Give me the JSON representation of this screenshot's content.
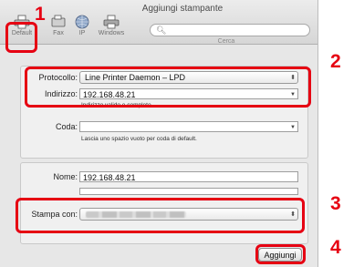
{
  "window": {
    "title": "Aggiungi stampante"
  },
  "toolbar": {
    "items": [
      {
        "label": "Default",
        "icon": "printer-icon"
      },
      {
        "label": "Fax",
        "icon": "fax-icon"
      },
      {
        "label": "IP",
        "icon": "globe-icon"
      },
      {
        "label": "Windows",
        "icon": "windows-printer-icon"
      }
    ],
    "search_label": "Cerca",
    "search_value": ""
  },
  "form": {
    "protocol_label": "Protocollo:",
    "protocol_value": "Line Printer Daemon – LPD",
    "address_label": "Indirizzo:",
    "address_value": "192.168.48.21",
    "address_hint": "Indirizzo valido e completo.",
    "queue_label": "Coda:",
    "queue_value": "",
    "queue_hint": "Lascia uno spazio vuoto per coda di default.",
    "name_label": "Nome:",
    "name_value": "192.168.48.21",
    "location_value": "",
    "print_with_label": "Stampa con:",
    "add_button": "Aggiungi"
  },
  "callouts": [
    "1",
    "2",
    "3",
    "4"
  ],
  "colors": {
    "callout": "#e60012"
  }
}
